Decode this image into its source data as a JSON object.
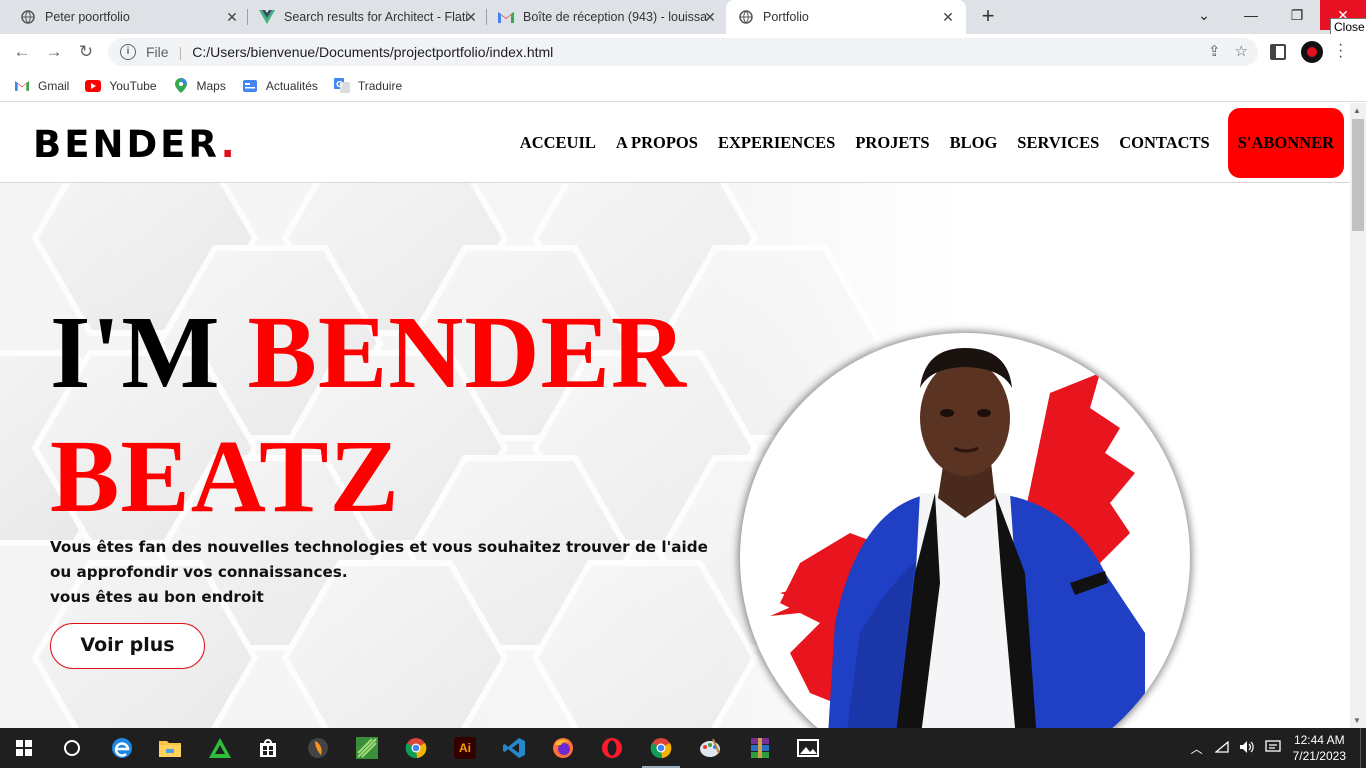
{
  "browser": {
    "tabs": [
      {
        "title": "Peter poortfolio",
        "icon": "globe-icon",
        "active": false
      },
      {
        "title": "Search results for Architect - Flati",
        "icon": "vuejs-icon",
        "active": false
      },
      {
        "title": "Boîte de réception (943) - louissa",
        "icon": "gmail-icon",
        "active": false
      },
      {
        "title": "Portfolio",
        "icon": "globe-icon",
        "active": true
      }
    ],
    "tooltip": "Close",
    "address": {
      "scheme_label": "File",
      "url": "C:/Users/bienvenue/Documents/projectportfolio/index.html"
    },
    "bookmarks": [
      {
        "label": "Gmail",
        "icon": "gmail-icon"
      },
      {
        "label": "YouTube",
        "icon": "youtube-icon"
      },
      {
        "label": "Maps",
        "icon": "maps-pin-icon"
      },
      {
        "label": "Actualités",
        "icon": "google-news-icon"
      },
      {
        "label": "Traduire",
        "icon": "google-translate-icon"
      }
    ]
  },
  "site": {
    "logo": {
      "text": "BENDER",
      "dot": "."
    },
    "nav": [
      {
        "label": "ACCEUIL"
      },
      {
        "label": "A PROPOS"
      },
      {
        "label": "EXPERIENCES"
      },
      {
        "label": "PROJETS"
      },
      {
        "label": "BLOG"
      },
      {
        "label": "SERVICES"
      },
      {
        "label": "CONTACTS"
      }
    ],
    "subscribe_label": "S'ABONNER",
    "hero": {
      "intro": "I'M ",
      "name_line1": "BENDER",
      "name_line2": "BEATZ",
      "tagline": [
        "Vous êtes fan des nouvelles technologies et vous souhaitez trouver de l'aide",
        "ou approfondir vos connaissances.",
        "vous êtes au bon endroit"
      ],
      "cta": "Voir plus"
    },
    "colors": {
      "accent": "#ff0000",
      "text": "#000000"
    }
  },
  "taskbar": {
    "apps": [
      "windows-start-icon",
      "cortana-icon",
      "edge-icon",
      "file-explorer-icon",
      "app-icon-green-triangle",
      "store-icon",
      "fl-studio-icon",
      "app-icon-green-leaf",
      "chrome-icon",
      "illustrator-icon",
      "vscode-icon",
      "firefox-icon",
      "opera-icon",
      "chrome-icon-active",
      "paint-icon",
      "winrar-icon",
      "photos-icon"
    ],
    "illustrator_label": "Ai",
    "time": "12:44 AM",
    "date": "7/21/2023"
  }
}
